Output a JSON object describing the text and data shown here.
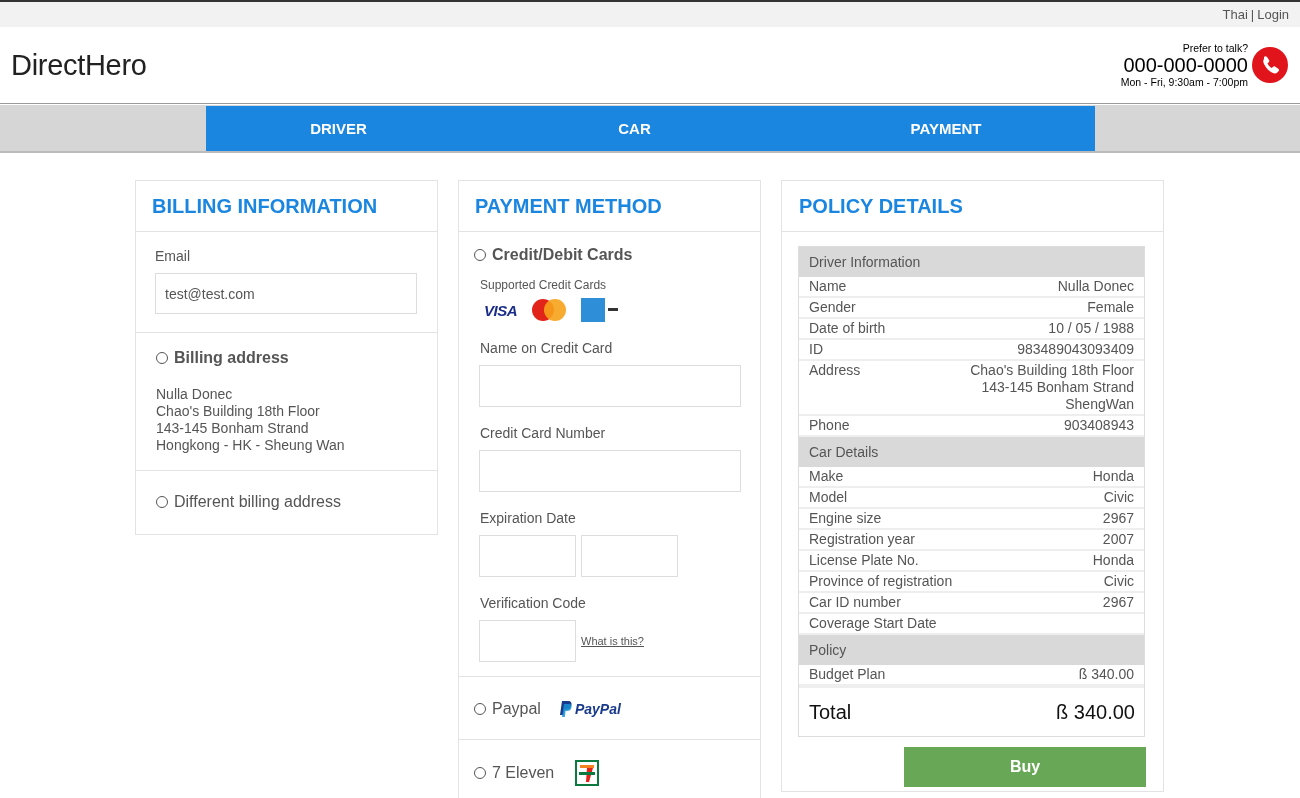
{
  "top_bar": {
    "links": [
      {
        "label": "Thai"
      },
      {
        "label": "Login"
      }
    ],
    "separator": "|"
  },
  "header": {
    "logo": "DirectHero",
    "contact": {
      "prompt": "Prefer to talk?",
      "phone": "000-000-0000",
      "hours": "Mon - Fri, 9:30am - 7:00pm"
    }
  },
  "steps": [
    {
      "label": "DRIVER",
      "active": true
    },
    {
      "label": "CAR",
      "active": true
    },
    {
      "label": "PAYMENT",
      "active": true
    }
  ],
  "billing": {
    "title": "BILLING INFORMATION",
    "email": {
      "label": "Email",
      "value": "test@test.com"
    },
    "options": [
      {
        "kind": "saved",
        "label": "Billing address",
        "selected": false,
        "address": [
          "Nulla Donec",
          "Chao's Building 18th Floor",
          "143-145 Bonham Strand",
          "Hongkong -  HK - Sheung Wan"
        ]
      },
      {
        "kind": "new",
        "label": "Different billing address",
        "selected": false
      }
    ]
  },
  "payment": {
    "title": "PAYMENT METHOD",
    "methods": [
      {
        "kind": "card",
        "label": "Credit/Debit Cards",
        "selected": false,
        "supported_label": "Supported Credit Cards",
        "card_logos": [
          {
            "kind": "visa",
            "text": "VISA"
          },
          {
            "kind": "mastercard"
          },
          {
            "kind": "amex"
          }
        ],
        "fields": [
          {
            "kind": "full",
            "label": "Name on Credit Card"
          },
          {
            "kind": "full",
            "label": "Credit Card Number"
          },
          {
            "kind": "split",
            "label": "Expiration Date"
          },
          {
            "kind": "short",
            "label": "Verification Code",
            "link": "What is this?"
          }
        ]
      },
      {
        "kind": "paypal",
        "label": "Paypal",
        "selected": false,
        "logo_text": "PayPal"
      },
      {
        "kind": "seven_eleven",
        "label": "7 Eleven",
        "selected": false
      }
    ]
  },
  "policy": {
    "title": "POLICY DETAILS",
    "sections": [
      {
        "heading": "Driver Information",
        "rows": [
          {
            "label": "Name",
            "value": [
              "Nulla Donec"
            ]
          },
          {
            "label": "Gender",
            "value": [
              "Female"
            ]
          },
          {
            "label": "Date of birth",
            "value": [
              "10 / 05 / 1988"
            ]
          },
          {
            "label": "ID",
            "value": [
              "983489043093409"
            ]
          },
          {
            "label": "Address",
            "value": [
              "Chao's Building 18th Floor",
              "143-145 Bonham Strand",
              "ShengWan"
            ]
          },
          {
            "label": "Phone",
            "value": [
              "903408943"
            ]
          }
        ]
      },
      {
        "heading": "Car Details",
        "rows": [
          {
            "label": "Make",
            "value": [
              "Honda"
            ]
          },
          {
            "label": "Model",
            "value": [
              "Civic"
            ]
          },
          {
            "label": "Engine size",
            "value": [
              "2967"
            ]
          },
          {
            "label": "Registration year",
            "value": [
              "2007"
            ]
          },
          {
            "label": "License Plate No.",
            "value": [
              "Honda"
            ]
          },
          {
            "label": "Province of registration",
            "value": [
              "Civic"
            ]
          },
          {
            "label": "Car ID number",
            "value": [
              "2967"
            ]
          },
          {
            "label": "Coverage Start Date",
            "value": []
          }
        ]
      },
      {
        "heading": "Policy",
        "rows": [
          {
            "label": "Budget Plan",
            "value": [
              "ß 340.00"
            ]
          }
        ]
      }
    ],
    "total": {
      "label": "Total",
      "value": "ß 340.00"
    },
    "buy": "Buy"
  }
}
